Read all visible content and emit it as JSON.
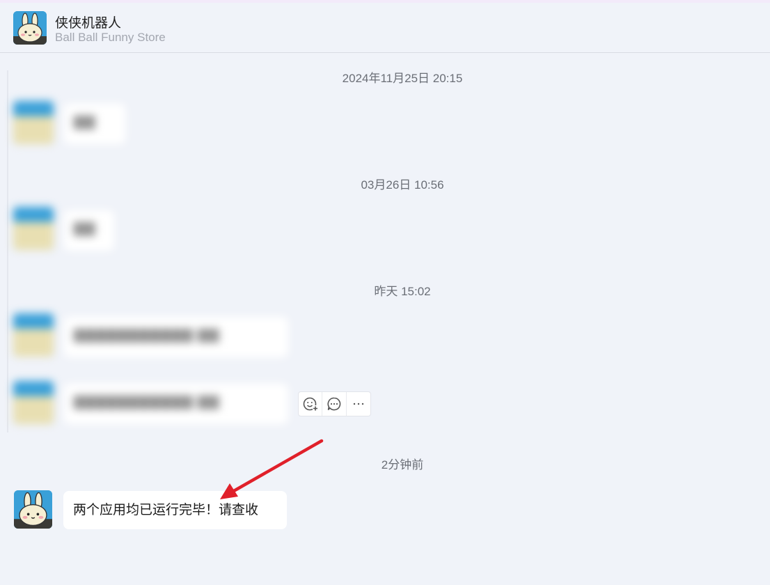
{
  "header": {
    "title": "侠侠机器人",
    "subtitle": "Ball Ball Funny Store",
    "avatar_icon": "bunny-avatar-icon"
  },
  "messages": {
    "timestamp_1": "2024年11月25日 20:15",
    "timestamp_2": "03月26日 10:56",
    "timestamp_3": "昨天 15:02",
    "timestamp_4": "2分钟前",
    "last_message": "两个应用均已运行完毕！请查收"
  },
  "action_bar": {
    "icons": [
      "add-reaction-icon",
      "reply-comment-icon",
      "more-icon"
    ]
  },
  "colors": {
    "background": "#f0f3f9",
    "bubble": "#ffffff",
    "arrow": "#e0202a",
    "avatar_bg": "#3aa0d8"
  }
}
